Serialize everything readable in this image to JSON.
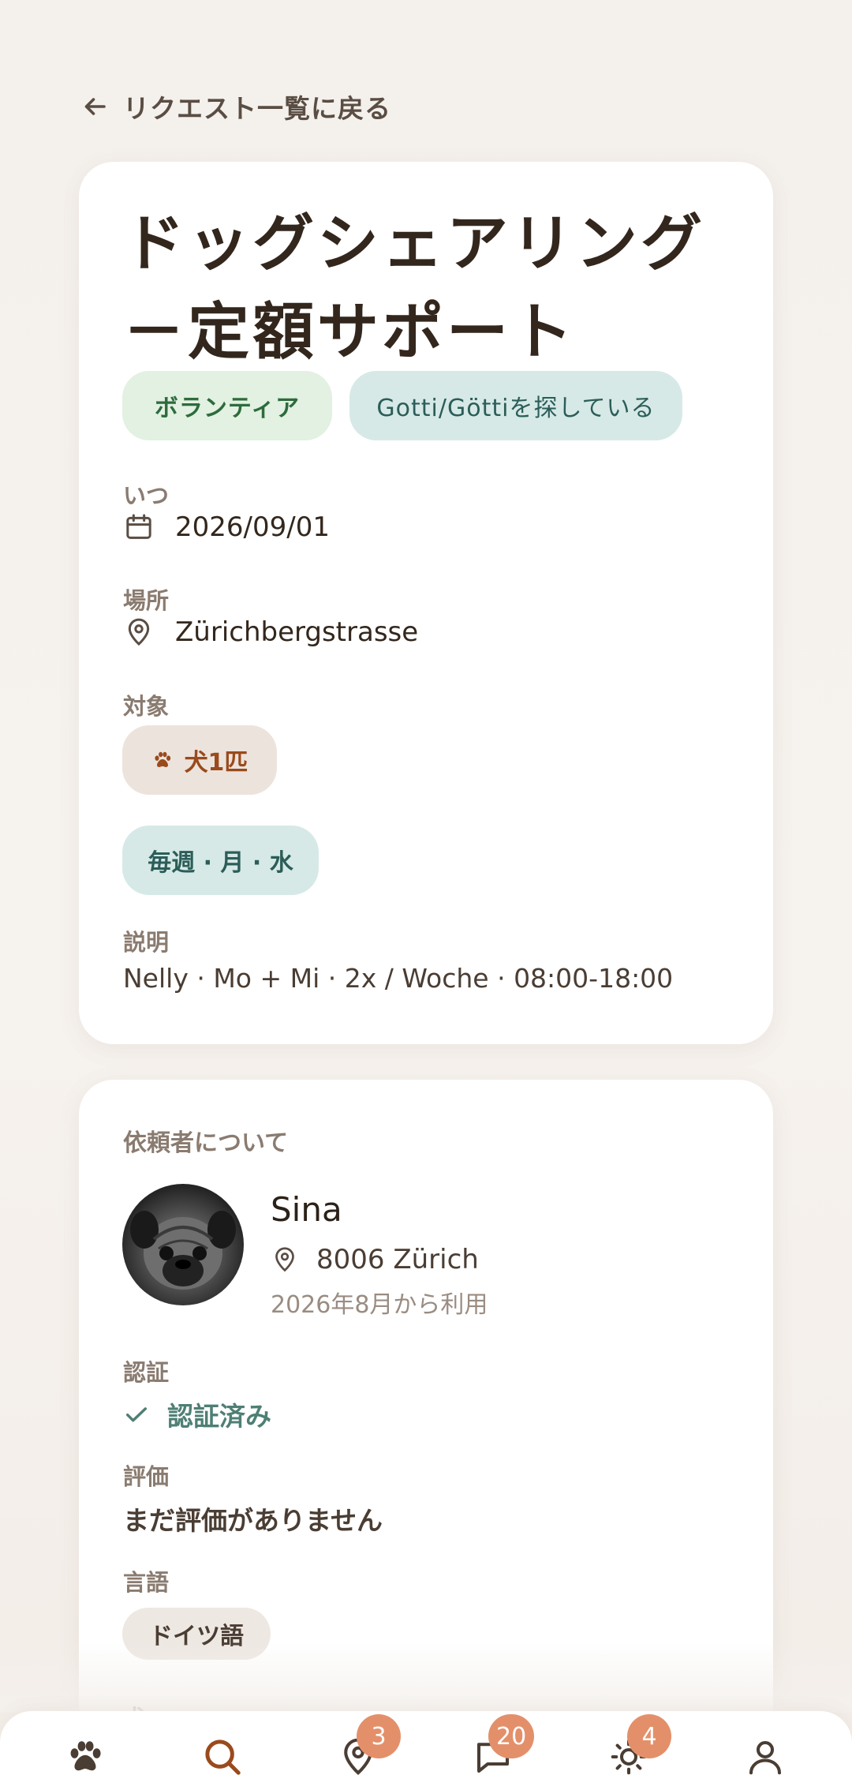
{
  "back_link": {
    "label": "リクエスト一覧に戻る"
  },
  "request": {
    "title": "ドッグシェアリング－定額サポート",
    "chips": [
      "ボランティア",
      "Gotti/Göttiを探している"
    ],
    "when": {
      "label": "いつ",
      "value": "2026/09/01"
    },
    "where": {
      "label": "場所",
      "value": "Zürichbergstrasse"
    },
    "target": {
      "label": "対象",
      "value": "犬1匹"
    },
    "schedule": "毎週 · 月 · 水",
    "description": {
      "label": "説明",
      "value": "Nelly · Mo + Mi · 2x / Woche · 08:00-18:00"
    }
  },
  "owner": {
    "heading": "依頼者について",
    "name": "Sina",
    "location": "8006 Zürich",
    "member_since": "2026年8月から利用",
    "verification": {
      "label": "認証",
      "value": "認証済み"
    },
    "rating": {
      "label": "評価",
      "value": "まだ評価がありません"
    },
    "languages": {
      "label": "言語",
      "values": [
        "ドイツ語"
      ]
    },
    "next_label": "犬"
  },
  "nav": {
    "badges": {
      "map": "3",
      "messages": "20",
      "activity": "4"
    }
  },
  "colors": {
    "background": "#f4f0ec",
    "accent": "#9a4a1c",
    "badge": "#e3906a",
    "verified": "#4e7f74"
  }
}
